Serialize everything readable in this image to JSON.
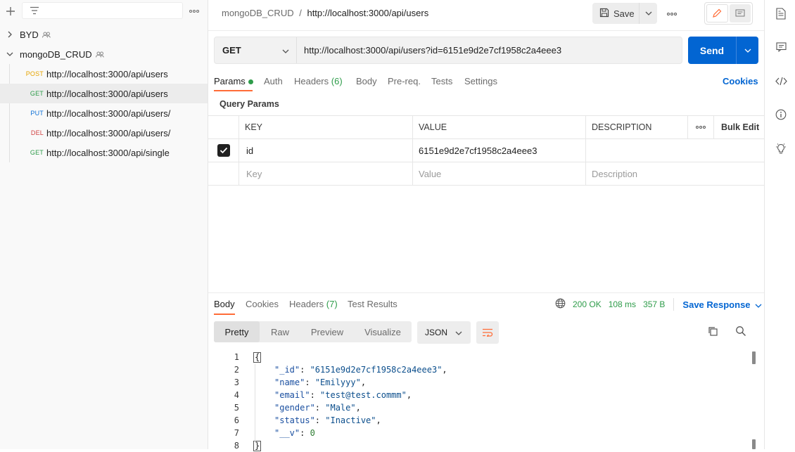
{
  "sidebar": {
    "collections": [
      {
        "name": "BYD",
        "expanded": false
      },
      {
        "name": "mongoDB_CRUD",
        "expanded": true
      }
    ],
    "requests": [
      {
        "method": "POST",
        "url": "http://localhost:3000/api/users",
        "color": "#e5a400"
      },
      {
        "method": "GET",
        "url": "http://localhost:3000/api/users",
        "color": "#2e9c4a"
      },
      {
        "method": "PUT",
        "url": "http://localhost:3000/api/users/",
        "color": "#0b6fd6"
      },
      {
        "method": "DEL",
        "url": "http://localhost:3000/api/users/",
        "color": "#d14343"
      },
      {
        "method": "GET",
        "url": "http://localhost:3000/api/single",
        "color": "#2e9c4a"
      }
    ]
  },
  "header": {
    "breadcrumb_parent": "mongoDB_CRUD",
    "breadcrumb_sep": "/",
    "breadcrumb_current": "http://localhost:3000/api/users",
    "save_label": "Save"
  },
  "request": {
    "method": "GET",
    "url": "http://localhost:3000/api/users?id=6151e9d2e7cf1958c2a4eee3",
    "send_label": "Send",
    "tabs": {
      "params": "Params",
      "auth": "Auth",
      "headers": "Headers",
      "headers_count": "(6)",
      "body": "Body",
      "prereq": "Pre-req.",
      "tests": "Tests",
      "settings": "Settings"
    },
    "cookies_label": "Cookies",
    "query_params_title": "Query Params",
    "table": {
      "headers": {
        "key": "KEY",
        "value": "VALUE",
        "description": "DESCRIPTION",
        "bulk_edit": "Bulk Edit"
      },
      "rows": [
        {
          "checked": true,
          "key": "id",
          "value": "6151e9d2e7cf1958c2a4eee3",
          "description": ""
        }
      ],
      "placeholders": {
        "key": "Key",
        "value": "Value",
        "description": "Description"
      }
    }
  },
  "response": {
    "tabs": {
      "body": "Body",
      "cookies": "Cookies",
      "headers": "Headers",
      "headers_count": "(7)",
      "test_results": "Test Results"
    },
    "status": "200 OK",
    "time": "108 ms",
    "size": "357 B",
    "save_response_label": "Save Response",
    "view_tabs": [
      "Pretty",
      "Raw",
      "Preview",
      "Visualize"
    ],
    "active_view": "Pretty",
    "format": "JSON",
    "code_lines": [
      {
        "n": "1",
        "text": "{"
      },
      {
        "n": "2",
        "key": "\"_id\"",
        "value": "\"6151e9d2e7cf1958c2a4eee3\"",
        "comma": ","
      },
      {
        "n": "3",
        "key": "\"name\"",
        "value": "\"Emilyyy\"",
        "comma": ","
      },
      {
        "n": "4",
        "key": "\"email\"",
        "value": "\"test@test.commm\"",
        "comma": ","
      },
      {
        "n": "5",
        "key": "\"gender\"",
        "value": "\"Male\"",
        "comma": ","
      },
      {
        "n": "6",
        "key": "\"status\"",
        "value": "\"Inactive\"",
        "comma": ","
      },
      {
        "n": "7",
        "key": "\"__v\"",
        "value": "0",
        "comma": ""
      },
      {
        "n": "8",
        "text": "}"
      }
    ]
  },
  "colors": {
    "accent": "#ff6c37",
    "primary": "#0265d2",
    "success": "#2e9c4a"
  }
}
